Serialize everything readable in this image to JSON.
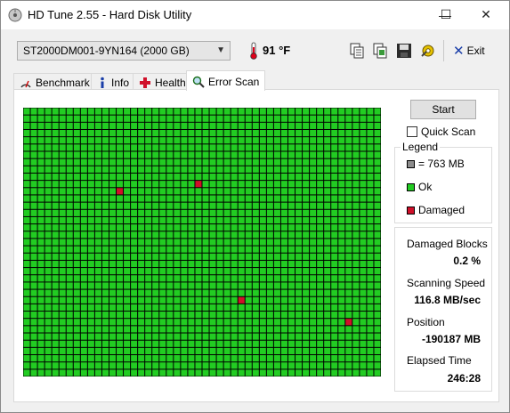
{
  "window": {
    "title": "HD Tune 2.55 - Hard Disk Utility",
    "minimize": "—",
    "maximize": "☐",
    "close": "✕"
  },
  "toolbar": {
    "drive": "ST2000DM001-9YN164 (2000 GB)",
    "temperature": "91 °F",
    "exit_label": "Exit"
  },
  "tabs": [
    {
      "label": "Benchmark",
      "icon": "benchmark-icon"
    },
    {
      "label": "Info",
      "icon": "info-icon"
    },
    {
      "label": "Health",
      "icon": "health-cross-icon"
    },
    {
      "label": "Error Scan",
      "icon": "magnifier-icon",
      "active": true
    }
  ],
  "scan": {
    "start_label": "Start",
    "quick_scan_label": "Quick Scan",
    "quick_scan_checked": false,
    "grid": {
      "columns": 50,
      "rows": 37,
      "ok_color": "#22cc22",
      "damaged_color": "#d0102a",
      "damaged_cells": [
        [
          13,
          11
        ],
        [
          24,
          10
        ],
        [
          30,
          26
        ],
        [
          45,
          29
        ]
      ]
    }
  },
  "legend": {
    "title": "Legend",
    "items": [
      {
        "label": "= 763 MB",
        "color": "#8c8c8c"
      },
      {
        "label": "Ok",
        "color": "#22cc22"
      },
      {
        "label": "Damaged",
        "color": "#d0102a"
      }
    ]
  },
  "stats": {
    "damaged_blocks_label": "Damaged Blocks",
    "damaged_blocks_value": "0.2 %",
    "scanning_speed_label": "Scanning Speed",
    "scanning_speed_value": "116.8 MB/sec",
    "position_label": "Position",
    "position_value": "-190187 MB",
    "elapsed_label": "Elapsed Time",
    "elapsed_value": "246:28"
  }
}
